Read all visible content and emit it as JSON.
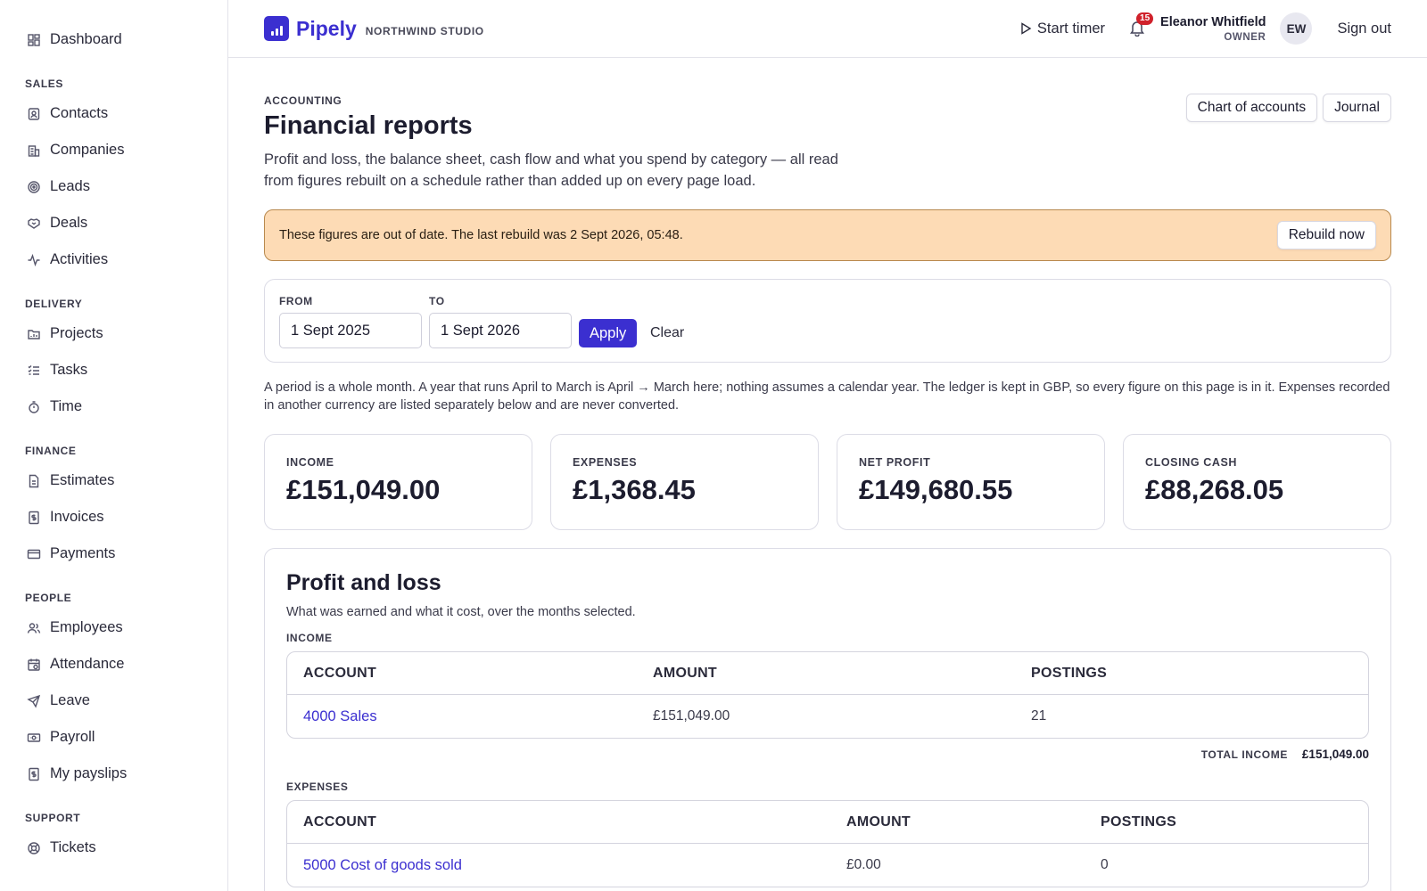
{
  "sidebar": {
    "top": [
      {
        "label": "Dashboard",
        "icon": "dashboard-icon"
      }
    ],
    "sections": [
      {
        "title": "SALES",
        "items": [
          {
            "label": "Contacts",
            "icon": "contacts-icon"
          },
          {
            "label": "Companies",
            "icon": "companies-icon"
          },
          {
            "label": "Leads",
            "icon": "leads-icon"
          },
          {
            "label": "Deals",
            "icon": "deals-icon"
          },
          {
            "label": "Activities",
            "icon": "activities-icon"
          }
        ]
      },
      {
        "title": "DELIVERY",
        "items": [
          {
            "label": "Projects",
            "icon": "projects-icon"
          },
          {
            "label": "Tasks",
            "icon": "tasks-icon"
          },
          {
            "label": "Time",
            "icon": "stopwatch-icon"
          }
        ]
      },
      {
        "title": "FINANCE",
        "items": [
          {
            "label": "Estimates",
            "icon": "estimates-icon"
          },
          {
            "label": "Invoices",
            "icon": "invoices-icon"
          },
          {
            "label": "Payments",
            "icon": "card-icon"
          }
        ]
      },
      {
        "title": "PEOPLE",
        "items": [
          {
            "label": "Employees",
            "icon": "employees-icon"
          },
          {
            "label": "Attendance",
            "icon": "attendance-icon"
          },
          {
            "label": "Leave",
            "icon": "plane-icon"
          },
          {
            "label": "Payroll",
            "icon": "payroll-icon"
          },
          {
            "label": "My payslips",
            "icon": "payslip-icon"
          }
        ]
      },
      {
        "title": "SUPPORT",
        "items": [
          {
            "label": "Tickets",
            "icon": "lifebuoy-icon"
          }
        ]
      }
    ]
  },
  "header": {
    "brand_name": "Pipely",
    "brand_sub": "NORTHWIND STUDIO",
    "timer_label": "Start timer",
    "notifications_count": "15",
    "user_name": "Eleanor Whitfield",
    "user_role": "OWNER",
    "avatar_initials": "EW",
    "signout_label": "Sign out"
  },
  "page": {
    "eyebrow": "ACCOUNTING",
    "title": "Financial reports",
    "description": "Profit and loss, the balance sheet, cash flow and what you spend by category — all read from figures rebuilt on a schedule rather than added up on every page load.",
    "actions": {
      "chart_of_accounts": "Chart of accounts",
      "journal": "Journal"
    },
    "alert": {
      "text": "These figures are out of date. The last rebuild was 2 Sept 2026, 05:48.",
      "button": "Rebuild now"
    },
    "filter": {
      "from_label": "FROM",
      "from_value": "1 Sept 2025",
      "to_label": "TO",
      "to_value": "1 Sept 2026",
      "apply_label": "Apply",
      "clear_label": "Clear"
    },
    "note": "A period is a whole month. A year that runs April to March is April → March here; nothing assumes a calendar year. The ledger is kept in GBP, so every figure on this page is in it. Expenses recorded in another currency are listed separately below and are never converted.",
    "stats": [
      {
        "label": "INCOME",
        "value": "£151,049.00"
      },
      {
        "label": "EXPENSES",
        "value": "£1,368.45"
      },
      {
        "label": "NET PROFIT",
        "value": "£149,680.55"
      },
      {
        "label": "CLOSING CASH",
        "value": "£88,268.05"
      }
    ],
    "pnl": {
      "title": "Profit and loss",
      "description": "What was earned and what it cost, over the months selected.",
      "income": {
        "label": "INCOME",
        "headers": [
          "ACCOUNT",
          "AMOUNT",
          "POSTINGS"
        ],
        "rows": [
          {
            "account": "4000 Sales",
            "amount": "£151,049.00",
            "postings": "21"
          }
        ],
        "total_label": "TOTAL INCOME",
        "total_value": "£151,049.00"
      },
      "expenses": {
        "label": "EXPENSES",
        "headers": [
          "ACCOUNT",
          "AMOUNT",
          "POSTINGS"
        ],
        "rows": [
          {
            "account": "5000 Cost of goods sold",
            "amount": "£0.00",
            "postings": "0"
          }
        ]
      }
    }
  },
  "colors": {
    "accent": "#3b2fd0",
    "alert_bg": "#fddbb5",
    "badge": "#d0212b"
  }
}
